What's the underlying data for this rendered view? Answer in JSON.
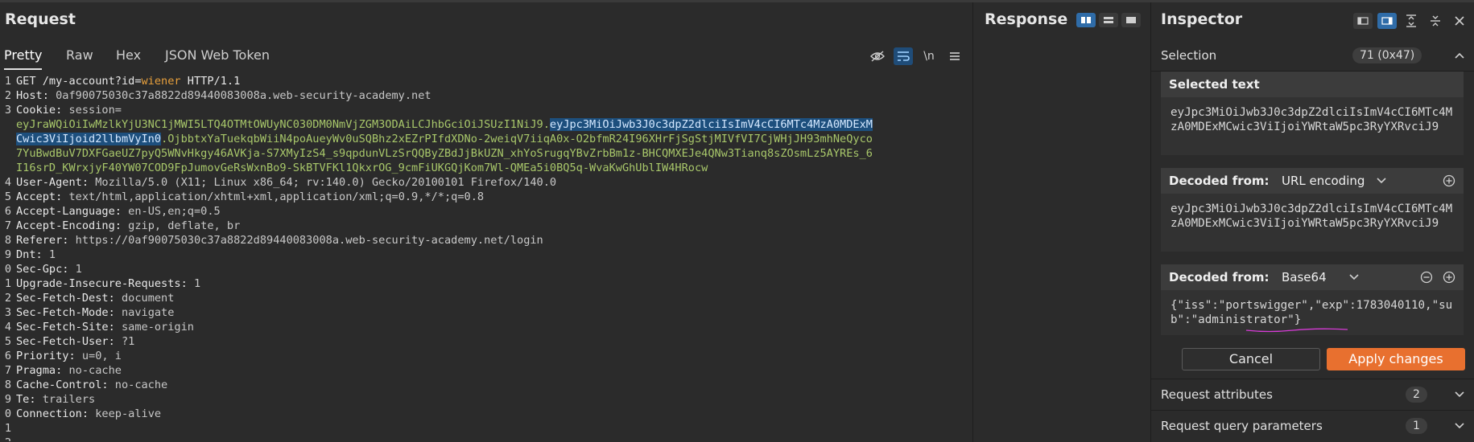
{
  "request": {
    "title": "Request",
    "tabs": [
      {
        "label": "Pretty",
        "active": true
      },
      {
        "label": "Raw",
        "active": false
      },
      {
        "label": "Hex",
        "active": false
      },
      {
        "label": "JSON Web Token",
        "active": false
      }
    ],
    "toolbar": {
      "newline_label": "\\n"
    },
    "lines": [
      {
        "n": "1",
        "parts": [
          [
            "GET /my-account?id=",
            "hn"
          ],
          [
            "wiener",
            "orange"
          ],
          [
            " HTTP/1.1",
            "hn"
          ]
        ]
      },
      {
        "n": "2",
        "parts": [
          [
            "Host: ",
            "hn"
          ],
          [
            "0af90075030c37a8822d89440083008a.web-security-academy.net",
            "val"
          ]
        ]
      },
      {
        "n": "3",
        "parts": [
          [
            "Cookie: ",
            "hn"
          ],
          [
            "session=",
            "val"
          ]
        ]
      },
      {
        "n": "",
        "parts": [
          [
            "eyJraWQiOiIwMzlkYjU3NC1jMWI5LTQ4OTMtOWUyNC030DM0NmVjZGM3ODAiLCJhbGciOiJSUzI1NiJ9.",
            "grn"
          ],
          [
            "eyJpc3MiOiJwb3J0c3dpZ2dlciIsImV4cCI6MTc4MzA0MDExM",
            "sel"
          ]
        ]
      },
      {
        "n": "",
        "parts": [
          [
            "Cwic3ViIjoid2llbmVyIn0",
            "sel"
          ],
          [
            ".OjbbtxYaTuekqbWiiN4poAueyWv0uSQBhz2xEZrPIfdXDNo-2weiqV7iiqA0x-O2bfmR24I96XHrFjSgStjMIVfVI7CjWHjJH93mhNeQyco",
            "grn"
          ]
        ]
      },
      {
        "n": "",
        "parts": [
          [
            "7YuBwdBuV7DXFGaeUZ7pyQ5WNvHkgy46AVKja-S7XMyIzS4_s9qpdunVLzSrQQByZBdJjBkUZN_xhYoSrugqYBvZrbBm1z-BHCQMXEJe4QNw3Tianq8sZOsmLz5AYREs_6",
            "grn"
          ]
        ]
      },
      {
        "n": "",
        "parts": [
          [
            "I16srD_KWrxjyF40YW07COD9FpJumovGeRsWxnBo9-SkBTVFKl1QkxrOG_9cmFiUKGQjKom7Wl-QMEa5i0BQ5q-WvaKwGhUblIW4HRocw",
            "grn"
          ]
        ]
      },
      {
        "n": "4",
        "parts": [
          [
            "User-Agent: ",
            "hn"
          ],
          [
            "Mozilla/5.0 (X11; Linux x86_64; rv:140.0) Gecko/20100101 Firefox/140.0",
            "val"
          ]
        ]
      },
      {
        "n": "5",
        "parts": [
          [
            "Accept: ",
            "hn"
          ],
          [
            "text/html,application/xhtml+xml,application/xml;q=0.9,*/*;q=0.8",
            "val"
          ]
        ]
      },
      {
        "n": "6",
        "parts": [
          [
            "Accept-Language: ",
            "hn"
          ],
          [
            "en-US,en;q=0.5",
            "val"
          ]
        ]
      },
      {
        "n": "7",
        "parts": [
          [
            "Accept-Encoding: ",
            "hn"
          ],
          [
            "gzip, deflate, br",
            "val"
          ]
        ]
      },
      {
        "n": "8",
        "parts": [
          [
            "Referer: ",
            "hn"
          ],
          [
            "https://0af90075030c37a8822d89440083008a.web-security-academy.net/login",
            "val"
          ]
        ]
      },
      {
        "n": "9",
        "parts": [
          [
            "Dnt: ",
            "hn"
          ],
          [
            "1",
            "val"
          ]
        ]
      },
      {
        "n": "0",
        "parts": [
          [
            "Sec-Gpc: ",
            "hn"
          ],
          [
            "1",
            "val"
          ]
        ]
      },
      {
        "n": "1",
        "parts": [
          [
            "Upgrade-Insecure-Requests: ",
            "hn"
          ],
          [
            "1",
            "val"
          ]
        ]
      },
      {
        "n": "2",
        "parts": [
          [
            "Sec-Fetch-Dest: ",
            "hn"
          ],
          [
            "document",
            "val"
          ]
        ]
      },
      {
        "n": "3",
        "parts": [
          [
            "Sec-Fetch-Mode: ",
            "hn"
          ],
          [
            "navigate",
            "val"
          ]
        ]
      },
      {
        "n": "4",
        "parts": [
          [
            "Sec-Fetch-Site: ",
            "hn"
          ],
          [
            "same-origin",
            "val"
          ]
        ]
      },
      {
        "n": "5",
        "parts": [
          [
            "Sec-Fetch-User: ",
            "hn"
          ],
          [
            "?1",
            "val"
          ]
        ]
      },
      {
        "n": "6",
        "parts": [
          [
            "Priority: ",
            "hn"
          ],
          [
            "u=0, i",
            "val"
          ]
        ]
      },
      {
        "n": "7",
        "parts": [
          [
            "Pragma: ",
            "hn"
          ],
          [
            "no-cache",
            "val"
          ]
        ]
      },
      {
        "n": "8",
        "parts": [
          [
            "Cache-Control: ",
            "hn"
          ],
          [
            "no-cache",
            "val"
          ]
        ]
      },
      {
        "n": "9",
        "parts": [
          [
            "Te: ",
            "hn"
          ],
          [
            "trailers",
            "val"
          ]
        ]
      },
      {
        "n": "0",
        "parts": [
          [
            "Connection: ",
            "hn"
          ],
          [
            "keep-alive",
            "val"
          ]
        ]
      },
      {
        "n": "1",
        "parts": []
      },
      {
        "n": "2",
        "parts": []
      }
    ]
  },
  "response": {
    "title": "Response"
  },
  "inspector": {
    "title": "Inspector",
    "selection": {
      "label": "Selection",
      "badge": "71 (0x47)"
    },
    "selected_text": {
      "title": "Selected text",
      "value": "eyJpc3MiOiJwb3J0c3dpZ2dlciIsImV4cCI6MTc4MzA0MDExMCwic3ViIjoiYWRtaW5pc3RyYXRvciJ9"
    },
    "decoded_url": {
      "title": "Decoded from:",
      "encoding": "URL encoding",
      "value": "eyJpc3MiOiJwb3J0c3dpZ2dlciIsImV4cCI6MTc4MzA0MDExMCwic3ViIjoiYWRtaW5pc3RyYXRvciJ9"
    },
    "decoded_b64": {
      "title": "Decoded from:",
      "encoding": "Base64",
      "value": "{\"iss\":\"portswigger\",\"exp\":1783040110,\"sub\":\"administrator\"}"
    },
    "cancel_label": "Cancel",
    "apply_label": "Apply changes",
    "request_attributes": {
      "label": "Request attributes",
      "badge": "2"
    },
    "request_query": {
      "label": "Request query parameters",
      "badge": "1"
    },
    "colors": {
      "accent": "#e8702f",
      "selection": "#1d4f7d",
      "underline": "#d63bd6"
    }
  }
}
